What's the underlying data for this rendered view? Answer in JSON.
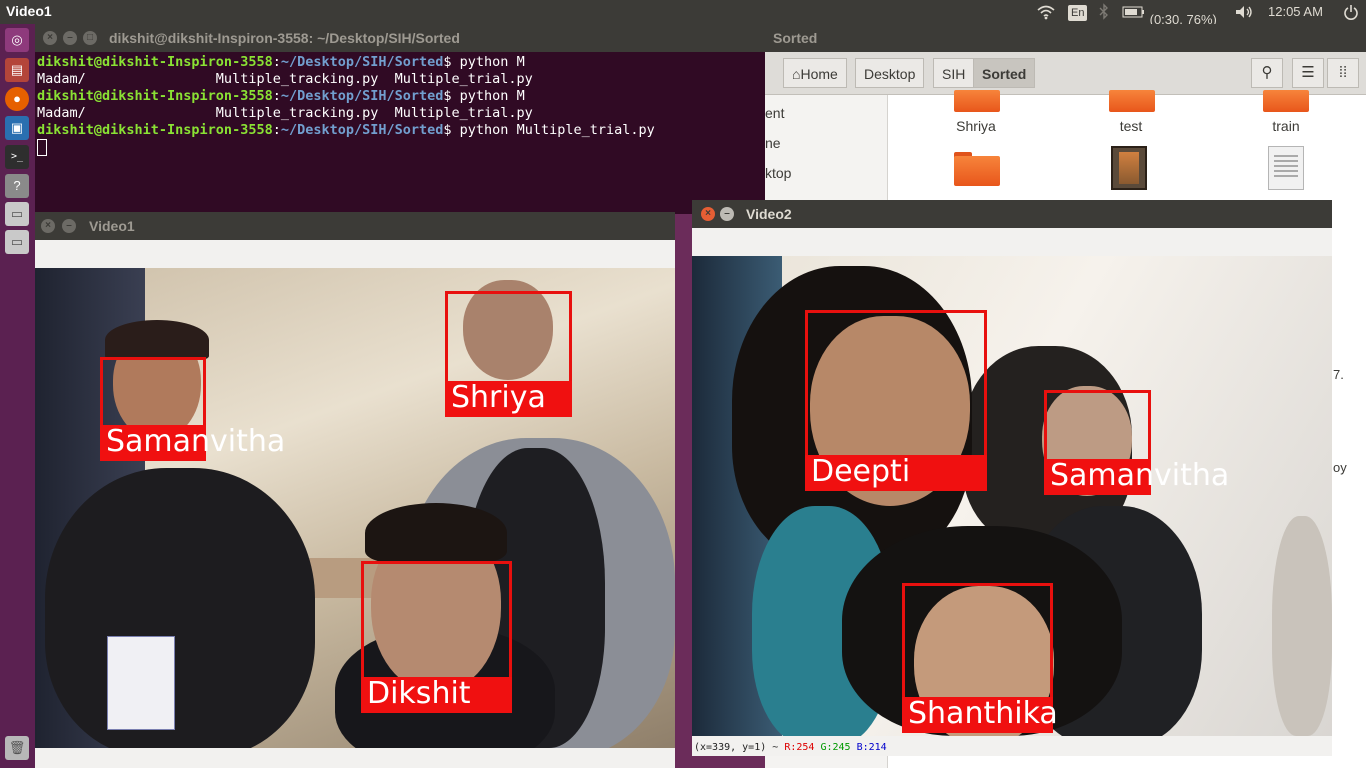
{
  "topbar": {
    "app_title": "Video1",
    "lang": "En",
    "battery": "(0:30, 76%)",
    "clock": "12:05 AM"
  },
  "launcher": {
    "items": [
      "ubuntu-icon",
      "files-icon",
      "firefox-icon",
      "app-icon",
      "terminal-icon",
      "help-icon",
      "drive-icon",
      "drive-icon",
      "trash-icon"
    ]
  },
  "terminal": {
    "title": "dikshit@dikshit-Inspiron-3558: ~/Desktop/SIH/Sorted",
    "prompt_user": "dikshit@dikshit-Inspiron-3558",
    "prompt_path": "~/Desktop/SIH/Sorted",
    "lines": [
      {
        "cmd": "python M"
      },
      {
        "out": "Madam/                Multiple_tracking.py  Multiple_trial.py"
      },
      {
        "cmd": "python M"
      },
      {
        "out": "Madam/                Multiple_tracking.py  Multiple_trial.py"
      },
      {
        "cmd": "python Multiple_trial.py"
      }
    ]
  },
  "files": {
    "title": "Sorted",
    "breadcrumbs": [
      "Home",
      "Desktop",
      "SIH",
      "Sorted"
    ],
    "sidebar_partial": [
      "ent",
      "ne",
      "ktop"
    ],
    "items_row1": [
      "Shriya",
      "test",
      "train"
    ],
    "edge_text": [
      "7.",
      "oy"
    ]
  },
  "video1": {
    "title": "Video1",
    "faces": [
      {
        "name": "Samanvitha"
      },
      {
        "name": "Shriya"
      },
      {
        "name": "Dikshit"
      }
    ]
  },
  "video2": {
    "title": "Video2",
    "faces": [
      {
        "name": "Deepti"
      },
      {
        "name": "Samanvitha"
      },
      {
        "name": "Shanthika"
      }
    ],
    "status_prefix": "(x=339, y=1) ~ ",
    "status_r": "R:254",
    "status_g": "G:245",
    "status_b": "B:214"
  },
  "colors": {
    "terminal_bg": "#300a24",
    "launcher_bg": "#5b2151",
    "panel_bg": "#3c3b37",
    "face_box": "#e8100e",
    "close_button": "#e65e34"
  }
}
